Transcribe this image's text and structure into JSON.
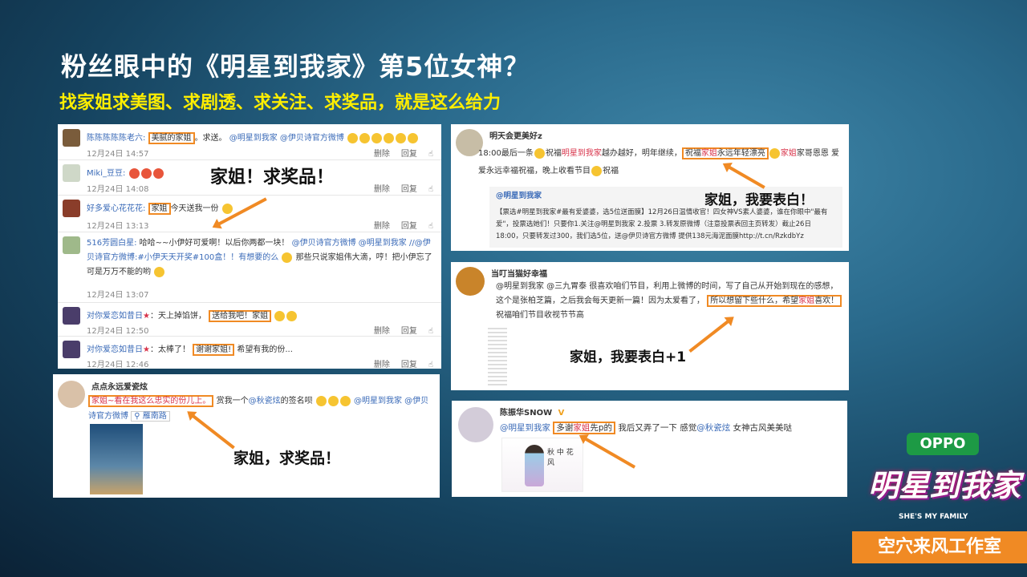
{
  "header": {
    "title": "粉丝眼中的《明星到我家》第5位女神？",
    "subtitle": "找家姐求美图、求剧透、求关注、求奖品，就是这么给力"
  },
  "panel_left": {
    "comments": [
      {
        "user": "陈陈陈陈陈老六:",
        "text_hl": "美腻的家姐",
        "text_after": "。求送。",
        "mentions": "@明星到我家 @伊贝诗官方微博",
        "time": "12月24日 14:57"
      },
      {
        "user": "Miki_豆豆:",
        "text_hl": "",
        "text_after": "",
        "mentions": "",
        "time": "12月24日 14:08"
      },
      {
        "user": "好多爱心花花花:",
        "text_hl": "家姐",
        "text_after": "今天送我一份",
        "mentions": "",
        "time": "12月24日 13:13"
      },
      {
        "user": "516芳圆白星:",
        "text_hl": "",
        "text_after": "哈哈~~小伊好可爱啊！以后你两都一块！",
        "mentions": "@伊贝诗官方微博 @明星到我家 //@伊贝诗官方微博:#小伊天天开奖#100盒！！有想要的么",
        "text_more": "那些只说家姐伟大滴，哼！把小伊忘了可是万万不能的哟",
        "time": "12月24日 13:07"
      },
      {
        "user": "对你爱恋如昔日",
        "text_hl": "送给我吧！家姐",
        "text_after": "：天上掉馅饼，",
        "mentions": "",
        "time": "12月24日 12:50"
      },
      {
        "user": "对你爱恋如昔日",
        "text_hl": "谢谢家姐!",
        "text_after": "：太棒了！",
        "text_tail": "希望有我的份...",
        "mentions": "",
        "time": "12月24日 12:46"
      }
    ],
    "actions": {
      "delete": "删除",
      "reply": "回复"
    },
    "callout": "家姐！求奖品！"
  },
  "panel_bottom_left": {
    "user": "点点永远爱瓷炫",
    "text_hl": "家姐~看在我这么忠实的份儿上。",
    "text_after": "赏我一个",
    "mention1": "@秋瓷炫",
    "text_mid": "的签名呗",
    "mention2": "@明星到我家",
    "mention3": "@伊贝诗官方微博",
    "location": "雁南路",
    "callout": "家姐，求奖品！"
  },
  "panel_right1": {
    "user": "明天会更美好z",
    "line1_pre": "18:00最后一条",
    "line1_mid": "祝福",
    "line1_show": "明星到我家",
    "line1_after": "越办越好，明年继续，",
    "line1_hl_pre": "祝福",
    "line1_hl_red": "家姐",
    "line1_hl_post": "永远年轻漂亮",
    "line1_end_red": "家姐",
    "line1_end": "家哥恩恩",
    "line2": "爱爱永远幸福祝福，晚上收看节目",
    "line2_end": "祝福",
    "quote_user": "@明星到我家",
    "quote_text": "【票选#明星到我家#最有爱婆婆，选5位送面膜】12月26日温情收官！四女神VS素人婆婆，谁在你眼中\"最有爱\"，投票选她们！只要你1.关注@明星到我家 2.投票 3.转发原微博（注意投票表回主页转发）截止26日18:00，只要转发过300，我们选5位，送@伊贝诗官方微博 提供138元海泥面膜http://t.cn/RzkdbYz",
    "callout": "家姐，我要表白！"
  },
  "panel_right2": {
    "user": "当叮当猫好幸福",
    "text1": "@明星到我家 @三九胃泰 很喜欢咱们节目，利用上微博的时间，写了自己从开始到现在的感想，这个是张柏芝篇，之后我会每天更新一篇！因为太爱看了，",
    "text_hl_pre": "所以想留下些什么，希望",
    "text_hl_red": "家姐",
    "text_hl_post": "喜欢！",
    "text_end": "祝福咱们节目收视节节高",
    "callout": "家姐，我要表白+1"
  },
  "panel_right3": {
    "user": "陈振华SNOW",
    "badge": "V",
    "mention": "@明星到我家",
    "hl_pre": "多谢",
    "hl_red": "家姐",
    "hl_post": "先p的",
    "text_after": "我后又弄了一下 感觉",
    "mention2": "@秋瓷炫",
    "text_end": "女神古风美美哒",
    "image_text": "秋 中 花 风"
  },
  "branding": {
    "sponsor": "OPPO",
    "show": "明星到我家",
    "show_en": "SHE'S MY FAMILY",
    "studio": "空穴来风工作室"
  },
  "colors": {
    "accent": "#f08a24",
    "title": "#ffffff",
    "subtitle": "#ffee00",
    "link": "#3b6bb8",
    "highlight_text": "#d8334a",
    "brand_green": "#1d9a45"
  }
}
